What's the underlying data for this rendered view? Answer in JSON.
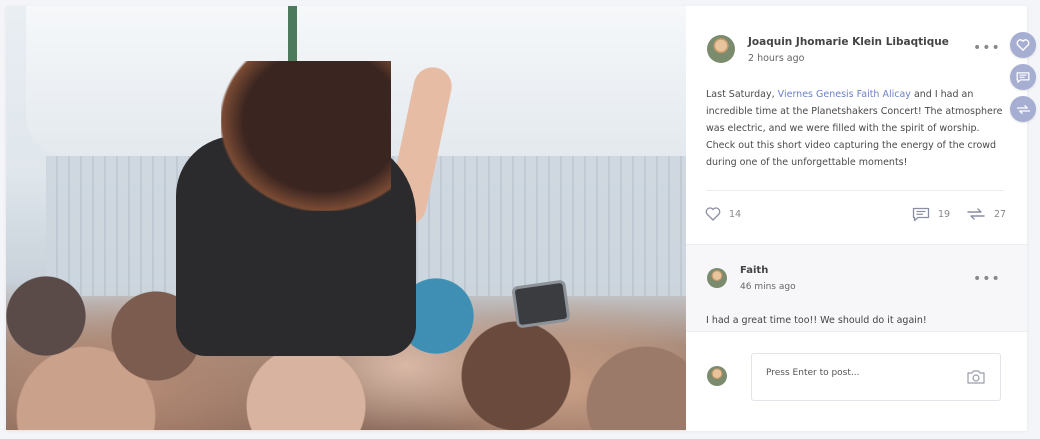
{
  "post": {
    "author": "Joaquin Jhomarie Klein Libaqtique",
    "time": "2 hours ago",
    "body": {
      "before": "Last Saturday, ",
      "mention": "Viernes Genesis Faith Alicay",
      "after": " and I had an incredible time at the Planetshakers Concert! The atmosphere was electric, and we were filled with the spirit of worship. Check out this short video capturing the energy of the crowd during one of the unforgettable moments!"
    },
    "likes": "14",
    "comments": "19",
    "shares": "27"
  },
  "comment": {
    "author": "Faith",
    "time": "46 mins ago",
    "text": "I had a great time too!! We should do it again!"
  },
  "composer": {
    "placeholder": "Press Enter to post..."
  },
  "colors": {
    "mention": "#6b82c4",
    "fab": "#a6aed2",
    "icon": "#8a8ea3"
  },
  "icons": [
    "heart-icon",
    "comment-icon",
    "share-icon",
    "more-icon",
    "camera-icon"
  ]
}
